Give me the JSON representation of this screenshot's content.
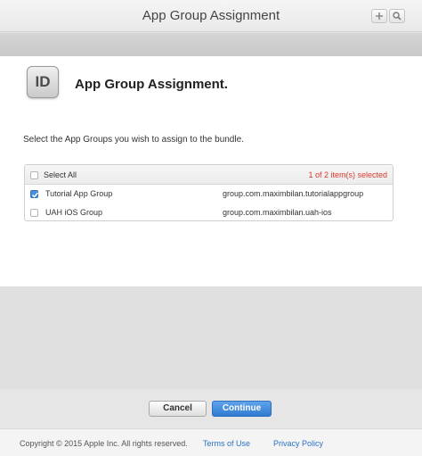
{
  "window": {
    "title": "App Group Assignment"
  },
  "main": {
    "icon_text": "ID",
    "heading": "App Group Assignment.",
    "instruction": "Select the App Groups you wish to assign to the bundle."
  },
  "table": {
    "select_all_label": "Select All",
    "selection_count": "1 of 2 item(s) selected",
    "rows": [
      {
        "name": "Tutorial App Group",
        "identifier": "group.com.maximbilan.tutorialappgroup",
        "checked": true
      },
      {
        "name": "UAH iOS Group",
        "identifier": "group.com.maximbilan.uah-ios",
        "checked": false
      }
    ]
  },
  "buttons": {
    "cancel": "Cancel",
    "continue": "Continue"
  },
  "footer": {
    "copyright": "Copyright © 2015 Apple Inc. All rights reserved.",
    "terms": "Terms of Use",
    "privacy": "Privacy Policy"
  },
  "colors": {
    "accent": "#2f7bd2",
    "selection_count": "#d9392c",
    "link": "#2a72c4"
  },
  "icons": {
    "toolbar": [
      "plus-icon",
      "search-icon"
    ],
    "app": "id-icon"
  }
}
